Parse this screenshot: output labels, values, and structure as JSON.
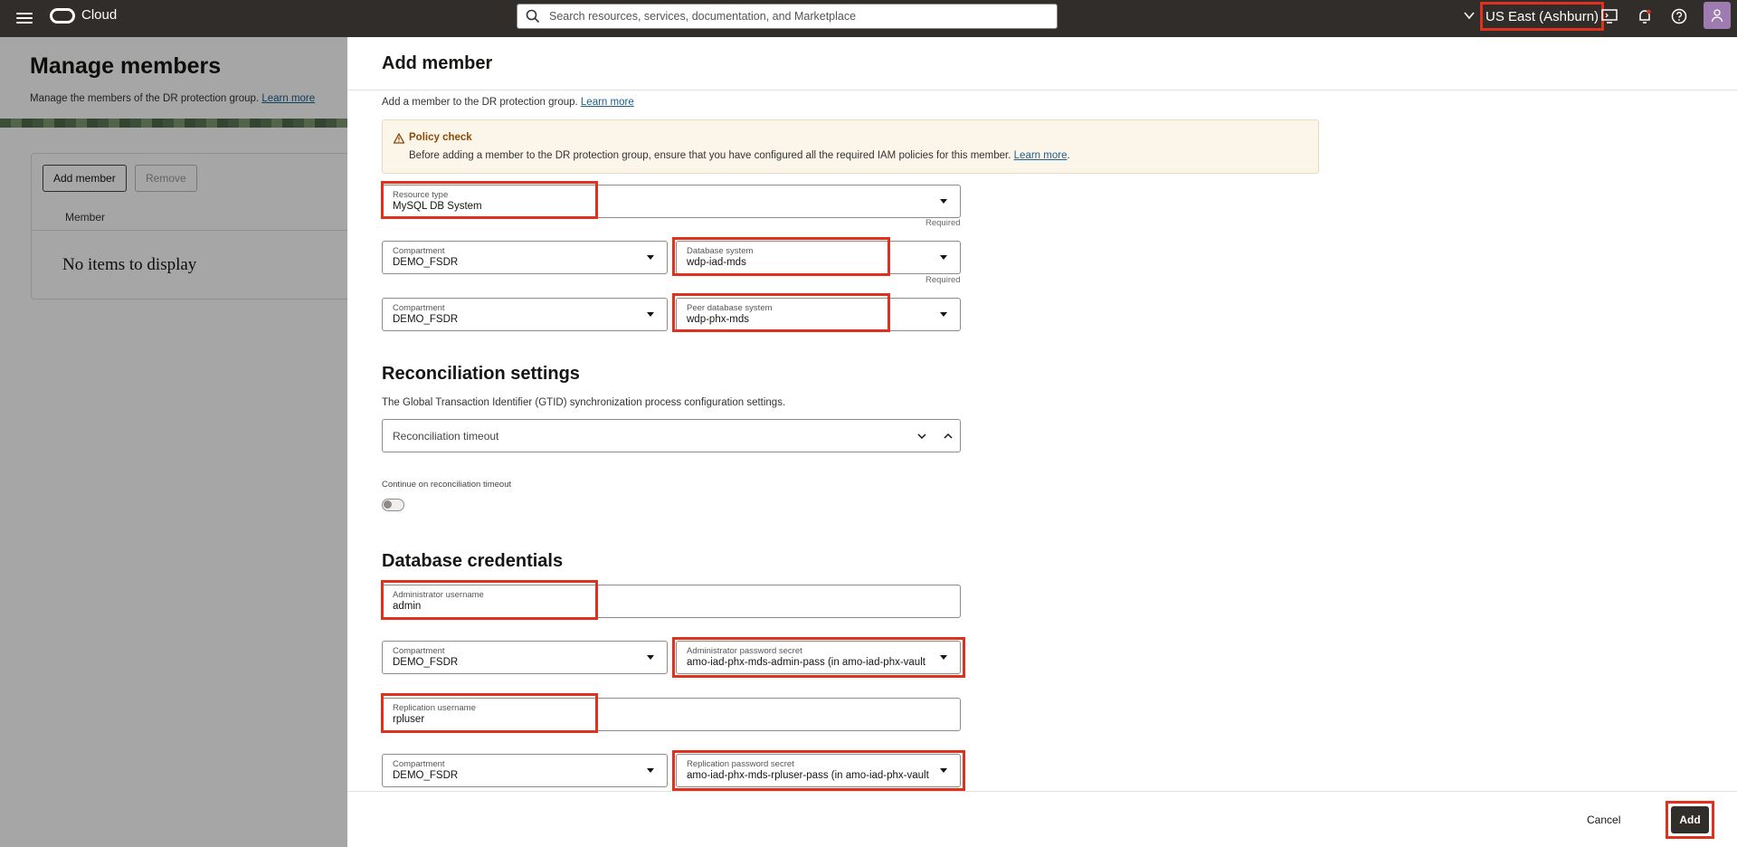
{
  "topbar": {
    "brand": "Cloud",
    "search_placeholder": "Search resources, services, documentation, and Marketplace",
    "region": "US East (Ashburn)"
  },
  "background_page": {
    "title": "Manage members",
    "description": "Manage the members of the DR protection group.",
    "learn_more": "Learn more",
    "add_member_label": "Add member",
    "remove_label": "Remove",
    "column_member": "Member",
    "empty_text": "No items to display"
  },
  "panel": {
    "title": "Add member",
    "description": "Add a member to the DR protection group.",
    "learn_more": "Learn more",
    "policy": {
      "heading": "Policy check",
      "text": "Before adding a member to the DR protection group, ensure that you have configured all the required IAM policies for this member.",
      "link": "Learn more",
      "trailing": "."
    },
    "resource_type": {
      "label": "Resource type",
      "value": "MySQL DB System",
      "hint": "Required"
    },
    "compartment_1": {
      "label": "Compartment",
      "value": "DEMO_FSDR"
    },
    "database_system": {
      "label": "Database system",
      "value": "wdp-iad-mds",
      "hint": "Required"
    },
    "compartment_2": {
      "label": "Compartment",
      "value": "DEMO_FSDR"
    },
    "peer_database_system": {
      "label": "Peer database system",
      "value": "wdp-phx-mds"
    },
    "reconciliation": {
      "title": "Reconciliation settings",
      "description": "The Global Transaction Identifier (GTID) synchronization process configuration settings.",
      "timeout_label": "Reconciliation timeout",
      "continue_label": "Continue on reconciliation timeout"
    },
    "credentials": {
      "title": "Database credentials",
      "admin_username": {
        "label": "Administrator username",
        "value": "admin"
      },
      "compartment_3": {
        "label": "Compartment",
        "value": "DEMO_FSDR"
      },
      "admin_password_secret": {
        "label": "Administrator password secret",
        "value": "amo-iad-phx-mds-admin-pass (in amo-iad-phx-vault"
      },
      "replication_username": {
        "label": "Replication username",
        "value": "rpluser"
      },
      "compartment_4": {
        "label": "Compartment",
        "value": "DEMO_FSDR"
      },
      "replication_password_secret": {
        "label": "Replication password secret",
        "value": "amo-iad-phx-mds-rpluser-pass (in amo-iad-phx-vault"
      }
    },
    "footer": {
      "cancel_label": "Cancel",
      "add_label": "Add"
    }
  },
  "colors": {
    "topbar": "#312d2a",
    "highlight": "#e0301e",
    "link": "#1b5e8c",
    "policy_bg": "#fcf5ea"
  }
}
